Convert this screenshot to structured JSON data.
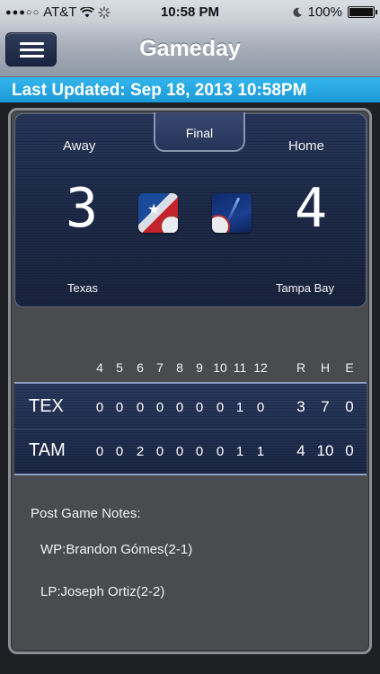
{
  "status_bar": {
    "signal": "●●●○○",
    "carrier": "AT&T",
    "wifi_icon": "wifi-icon",
    "activity_icon": "activity-spinner-icon",
    "time": "10:58 PM",
    "moon_icon": "moon-icon",
    "battery_pct": "100%",
    "battery_level": 1.0
  },
  "nav": {
    "title": "Gameday",
    "menu_icon": "hamburger-menu-icon"
  },
  "updated": {
    "text": "Last Updated: Sep 18, 2013 10:58PM"
  },
  "scoreboard": {
    "status": "Final",
    "away": {
      "label": "Away",
      "score": "3",
      "name": "Texas",
      "logo_icon": "texas-rangers-logo"
    },
    "home": {
      "label": "Home",
      "score": "4",
      "name": "Tampa Bay",
      "logo_icon": "tampa-bay-rays-logo"
    }
  },
  "linescore": {
    "innings": [
      "4",
      "5",
      "6",
      "7",
      "8",
      "9",
      "10",
      "11",
      "12"
    ],
    "totals_headers": [
      "R",
      "H",
      "E"
    ],
    "rows": [
      {
        "team": "TEX",
        "innings": [
          "0",
          "0",
          "0",
          "0",
          "0",
          "0",
          "0",
          "1",
          "0"
        ],
        "totals": [
          "3",
          "7",
          "0"
        ]
      },
      {
        "team": "TAM",
        "innings": [
          "0",
          "0",
          "2",
          "0",
          "0",
          "0",
          "0",
          "1",
          "1"
        ],
        "totals": [
          "4",
          "10",
          "0"
        ]
      }
    ]
  },
  "notes": {
    "title": "Post Game Notes:",
    "items": [
      "WP:Brandon Gómes(2-1)",
      "LP:Joseph Ortiz(2-2)"
    ]
  },
  "colors": {
    "banner": "#1fa3df",
    "card_navy": "#1e2b49",
    "panel_gray": "#4a4b4f"
  }
}
